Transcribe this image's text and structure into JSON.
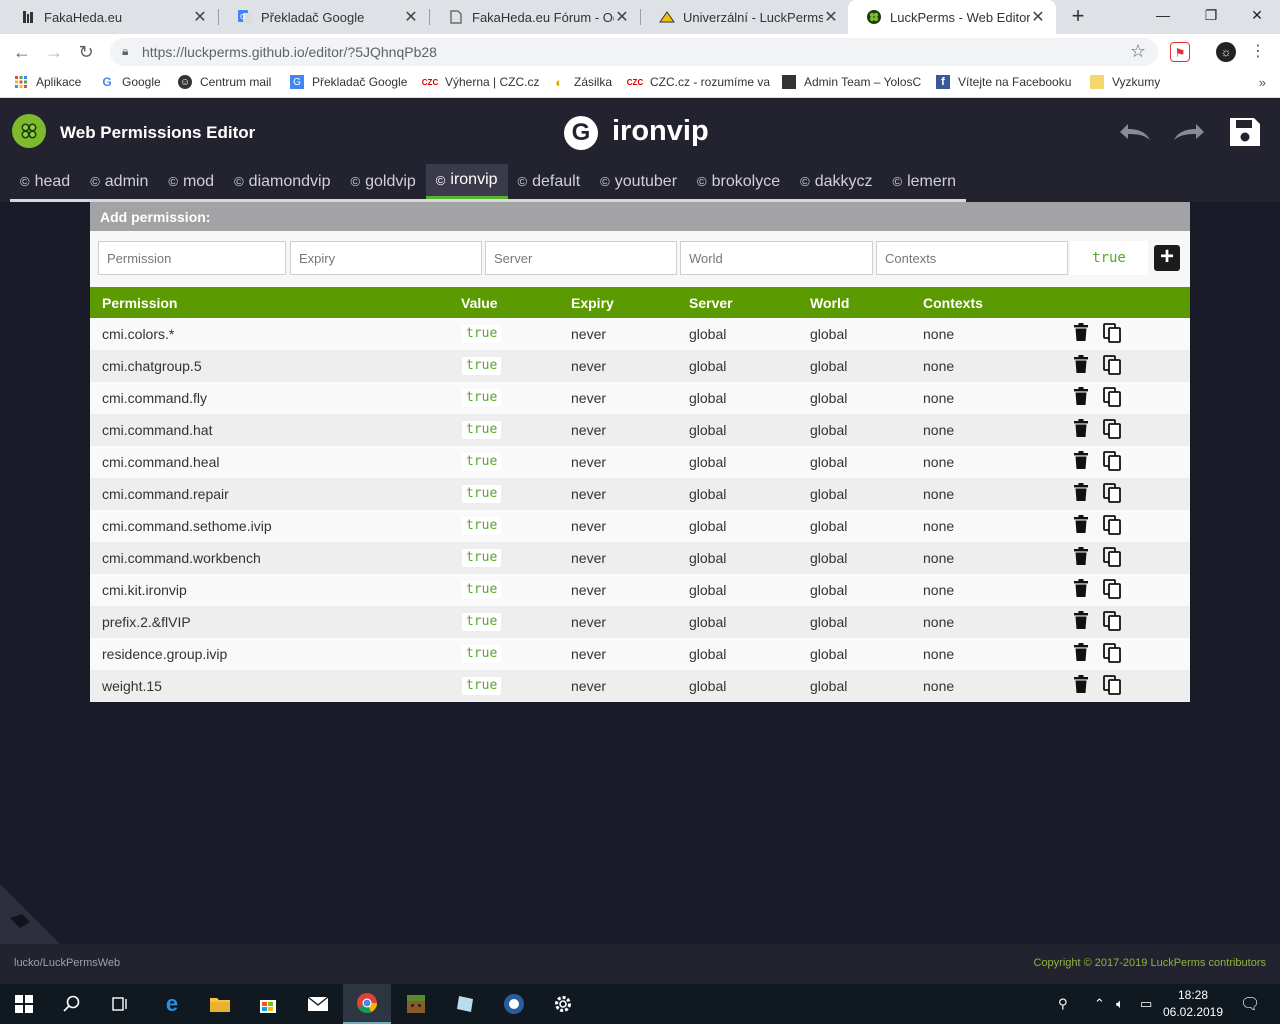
{
  "browser": {
    "tabs": [
      {
        "title": "FakaHeda.eu",
        "icon": "fakaheda-icon",
        "active": false
      },
      {
        "title": "Překladač Google",
        "icon": "google-translate-icon",
        "active": false
      },
      {
        "title": "FakaHeda.eu Fórum - Odesl",
        "icon": "document-icon",
        "active": false
      },
      {
        "title": "Univerzální - LuckPerms | R",
        "icon": "luckperms-wiki-icon",
        "active": false
      },
      {
        "title": "LuckPerms - Web Editor",
        "icon": "luckperms-icon",
        "active": true
      }
    ],
    "url": "https://luckperms.github.io/editor/?5JQhnqPb28",
    "bookmarks": [
      {
        "label": "Aplikace",
        "icon": "apps-icon"
      },
      {
        "label": "Google",
        "icon": "google-icon"
      },
      {
        "label": "Centrum mail",
        "icon": "centrum-icon"
      },
      {
        "label": "Překladač Google",
        "icon": "translate-icon"
      },
      {
        "label": "Výherna | CZC.cz",
        "icon": "czc-icon"
      },
      {
        "label": "Zásilka",
        "icon": "zasilka-icon"
      },
      {
        "label": "CZC.cz - rozumíme va",
        "icon": "czc-icon"
      },
      {
        "label": "Admin Team – YolosC",
        "icon": "admin-team-icon"
      },
      {
        "label": "Vítejte na Facebooku",
        "icon": "facebook-icon"
      },
      {
        "label": "Vyzkumy",
        "icon": "folder-icon"
      }
    ]
  },
  "app": {
    "title": "Web Permissions Editor",
    "group_badge": "G",
    "group_name": "ironvip",
    "group_tabs": [
      "head",
      "admin",
      "mod",
      "diamondvip",
      "goldvip",
      "ironvip",
      "default",
      "youtuber",
      "brokolyce",
      "dakkycz",
      "lemern"
    ],
    "active_tab": "ironvip"
  },
  "add_permission": {
    "label": "Add permission:",
    "placeholders": {
      "permission": "Permission",
      "expiry": "Expiry",
      "server": "Server",
      "world": "World",
      "contexts": "Contexts"
    },
    "value": "true",
    "add_button": "+"
  },
  "table": {
    "headers": {
      "permission": "Permission",
      "value": "Value",
      "expiry": "Expiry",
      "server": "Server",
      "world": "World",
      "contexts": "Contexts"
    },
    "rows": [
      {
        "permission": "cmi.colors.*",
        "value": "true",
        "expiry": "never",
        "server": "global",
        "world": "global",
        "contexts": "none"
      },
      {
        "permission": "cmi.chatgroup.5",
        "value": "true",
        "expiry": "never",
        "server": "global",
        "world": "global",
        "contexts": "none"
      },
      {
        "permission": "cmi.command.fly",
        "value": "true",
        "expiry": "never",
        "server": "global",
        "world": "global",
        "contexts": "none"
      },
      {
        "permission": "cmi.command.hat",
        "value": "true",
        "expiry": "never",
        "server": "global",
        "world": "global",
        "contexts": "none"
      },
      {
        "permission": "cmi.command.heal",
        "value": "true",
        "expiry": "never",
        "server": "global",
        "world": "global",
        "contexts": "none"
      },
      {
        "permission": "cmi.command.repair",
        "value": "true",
        "expiry": "never",
        "server": "global",
        "world": "global",
        "contexts": "none"
      },
      {
        "permission": "cmi.command.sethome.ivip",
        "value": "true",
        "expiry": "never",
        "server": "global",
        "world": "global",
        "contexts": "none"
      },
      {
        "permission": "cmi.command.workbench",
        "value": "true",
        "expiry": "never",
        "server": "global",
        "world": "global",
        "contexts": "none"
      },
      {
        "permission": "cmi.kit.ironvip",
        "value": "true",
        "expiry": "never",
        "server": "global",
        "world": "global",
        "contexts": "none"
      },
      {
        "permission": "prefix.2.&flVIP",
        "value": "true",
        "expiry": "never",
        "server": "global",
        "world": "global",
        "contexts": "none"
      },
      {
        "permission": "residence.group.ivip",
        "value": "true",
        "expiry": "never",
        "server": "global",
        "world": "global",
        "contexts": "none"
      },
      {
        "permission": "weight.15",
        "value": "true",
        "expiry": "never",
        "server": "global",
        "world": "global",
        "contexts": "none"
      }
    ]
  },
  "footer": {
    "left": "lucko/LuckPermsWeb",
    "right": "Copyright © 2017-2019 LuckPerms contributors"
  },
  "taskbar": {
    "time": "18:28",
    "date": "06.02.2019"
  },
  "colors": {
    "accent_green": "#5b9a00",
    "value_green": "#57a62d",
    "header_bg": "#23232f",
    "page_bg": "#1a1b28"
  }
}
